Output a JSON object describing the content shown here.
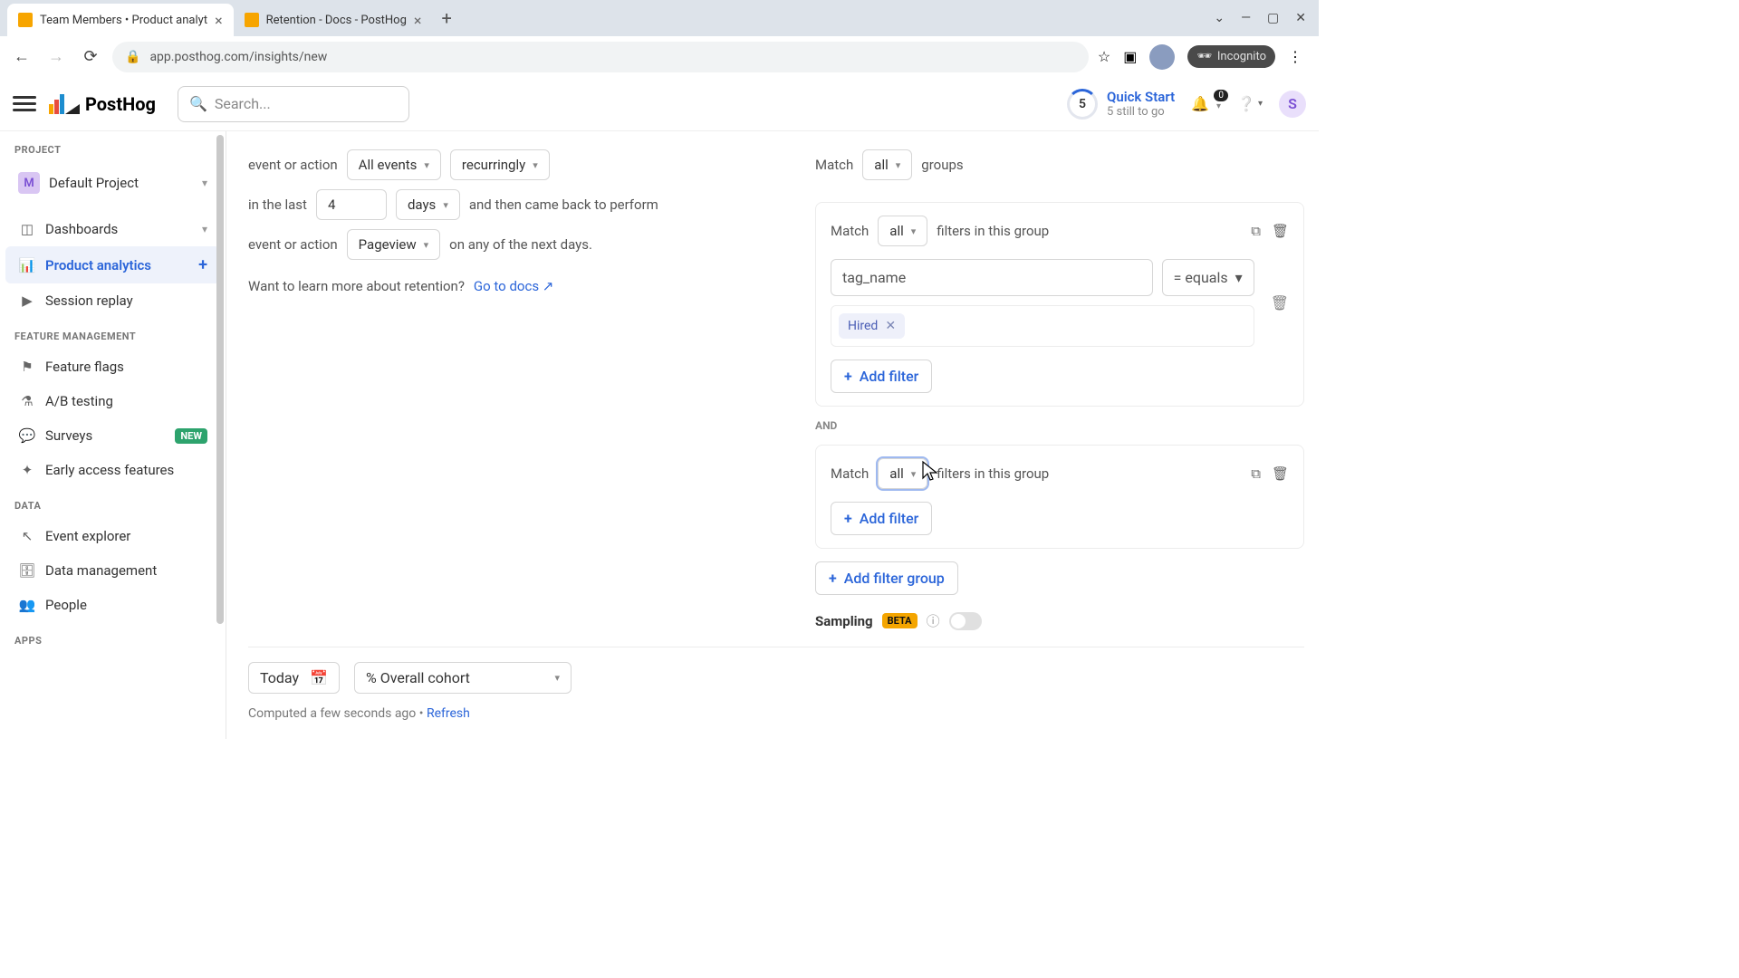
{
  "browser": {
    "tabs": [
      {
        "title": "Team Members • Product analyt",
        "active": true
      },
      {
        "title": "Retention - Docs - PostHog",
        "active": false
      }
    ],
    "url": "app.posthog.com/insights/new",
    "incognito_label": "Incognito",
    "window_controls": {
      "profile_chevron": "⌄"
    }
  },
  "header": {
    "logo_text": "PostHog",
    "search_placeholder": "Search...",
    "quick_start": {
      "number": "5",
      "title": "Quick Start",
      "subtitle": "5 still to go"
    },
    "notifications_badge": "0",
    "avatar_letter": "S"
  },
  "sidebar": {
    "project_section": "PROJECT",
    "project": {
      "initial": "M",
      "name": "Default Project"
    },
    "items_main": [
      {
        "label": "Dashboards",
        "icon": "dashboard",
        "has_chev": true
      },
      {
        "label": "Product analytics",
        "icon": "bars",
        "has_plus": true,
        "active": true
      },
      {
        "label": "Session replay",
        "icon": "play"
      }
    ],
    "feature_section": "FEATURE MANAGEMENT",
    "items_feature": [
      {
        "label": "Feature flags",
        "icon": "flag"
      },
      {
        "label": "A/B testing",
        "icon": "flask"
      },
      {
        "label": "Surveys",
        "icon": "chat",
        "pill": "NEW"
      },
      {
        "label": "Early access features",
        "icon": "star"
      }
    ],
    "data_section": "DATA",
    "items_data": [
      {
        "label": "Event explorer",
        "icon": "cursor"
      },
      {
        "label": "Data management",
        "icon": "db"
      },
      {
        "label": "People",
        "icon": "people"
      }
    ],
    "apps_section": "APPS"
  },
  "left": {
    "event_or_action": "event or action",
    "all_events": "All events",
    "recurringly": "recurringly",
    "in_the_last": "in the last",
    "count_value": "4",
    "days": "days",
    "and_then": "and then came back to perform",
    "pageview": "Pageview",
    "on_any": "on any of the next days.",
    "learn_prefix": "Want to learn more about retention? ",
    "learn_link": "Go to docs"
  },
  "right": {
    "match_word": "Match",
    "all": "all",
    "groups": "groups",
    "filters_group": "filters in this group",
    "tag_name": "tag_name",
    "equals": "= equals",
    "hired": "Hired",
    "add_filter": "Add filter",
    "and": "AND",
    "add_filter_group": "Add filter group",
    "sampling": "Sampling",
    "beta": "BETA"
  },
  "bottom": {
    "today": "Today",
    "overall": "% Overall cohort",
    "computed": "Computed a few seconds ago • ",
    "refresh": "Refresh"
  }
}
